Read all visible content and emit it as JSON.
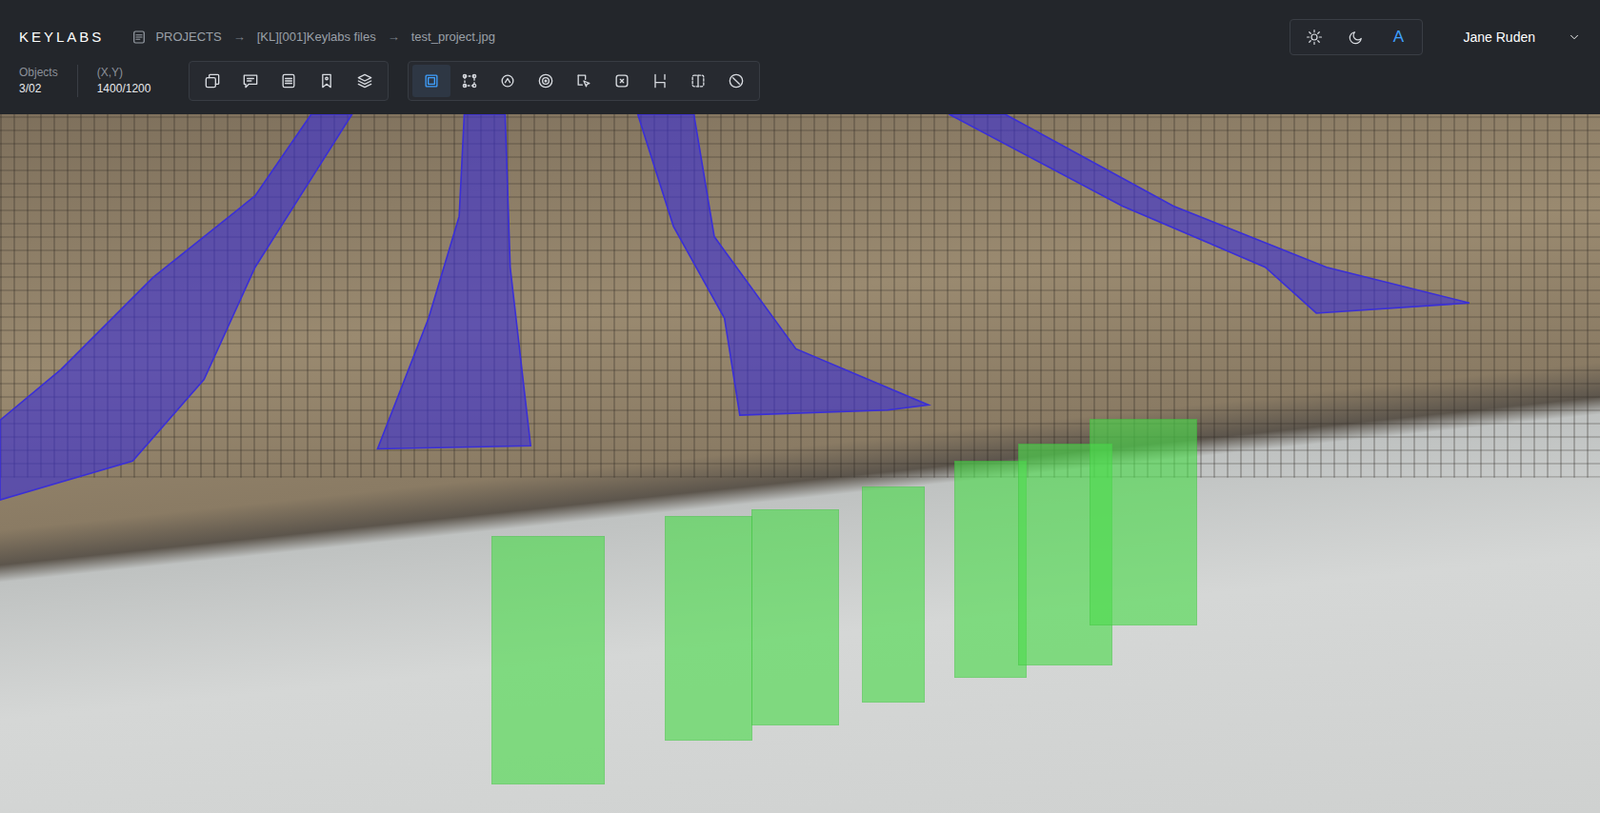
{
  "app": {
    "logo": "KEYLABS"
  },
  "breadcrumb": {
    "separator": "→",
    "items": [
      {
        "label": "PROJECTS"
      },
      {
        "label": "[KL][001]Keylabs files"
      },
      {
        "label": "test_project.jpg"
      }
    ]
  },
  "theme_modes": [
    {
      "kind": "light",
      "label": "",
      "selected": false
    },
    {
      "kind": "dark",
      "label": "",
      "selected": false
    },
    {
      "kind": "auto",
      "label": "A",
      "selected": true
    }
  ],
  "user": {
    "name": "Jane Ruden"
  },
  "stats": [
    {
      "label": "Objects",
      "value": "3/02"
    },
    {
      "label": "(X,Y)",
      "value": "1400/1200"
    }
  ],
  "toolbar_groups": [
    [
      {
        "kind": "copy",
        "selected": false
      },
      {
        "kind": "comment",
        "selected": false
      },
      {
        "kind": "list",
        "selected": false
      },
      {
        "kind": "tag",
        "selected": false
      },
      {
        "kind": "layers",
        "selected": false
      }
    ],
    [
      {
        "kind": "bbox",
        "selected": true
      },
      {
        "kind": "points",
        "selected": false
      },
      {
        "kind": "lasso",
        "selected": false
      },
      {
        "kind": "target",
        "selected": false
      },
      {
        "kind": "smart",
        "selected": false
      },
      {
        "kind": "cursor",
        "selected": false
      },
      {
        "kind": "skeleton",
        "selected": false
      },
      {
        "kind": "segment",
        "selected": false
      },
      {
        "kind": "ruler",
        "selected": false
      }
    ]
  ],
  "annotations": [
    {
      "kind": "polygon",
      "color": "#3a2fd6"
    },
    {
      "kind": "polygon",
      "color": "#3a2fd6"
    },
    {
      "kind": "polygon",
      "color": "#3a2fd6"
    },
    {
      "kind": "polygon",
      "color": "#3a2fd6"
    },
    {
      "kind": "box",
      "color": "#4cdc4c"
    },
    {
      "kind": "box",
      "color": "#4cdc4c"
    },
    {
      "kind": "box",
      "color": "#4cdc4c"
    },
    {
      "kind": "box",
      "color": "#4cdc4c"
    },
    {
      "kind": "box",
      "color": "#4cdc4c"
    },
    {
      "kind": "box",
      "color": "#4cdc4c"
    },
    {
      "kind": "box",
      "color": "#4cdc4c"
    }
  ]
}
